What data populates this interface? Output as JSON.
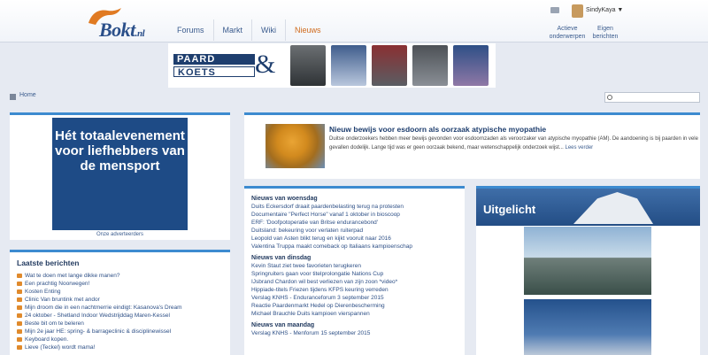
{
  "header": {
    "logo": {
      "text": "Bokt",
      "tld": ".nl"
    },
    "nav": [
      {
        "label": "Forums",
        "active": false
      },
      {
        "label": "Markt",
        "active": false
      },
      {
        "label": "Wiki",
        "active": false
      },
      {
        "label": "Nieuws",
        "active": true
      }
    ],
    "user": {
      "name": "SindyKaya ▼",
      "links": [
        {
          "line1": "Actieve",
          "line2": "onderwerpen"
        },
        {
          "line1": "Eigen",
          "line2": "berichten"
        }
      ]
    }
  },
  "banner": {
    "line1": "PAARD",
    "line2": "KOETS",
    "amp": "&"
  },
  "breadcrumb": {
    "home": "Home"
  },
  "search": {
    "placeholder": ""
  },
  "ad": {
    "text": "Hét totaalevenement voor liefhebbers van de mensport",
    "caption": "Onze adverteerders"
  },
  "latest": {
    "title": "Laatste berichten",
    "items": [
      "Wat te doen met lange dikke manen?",
      "Een prachtig Noorwegen!",
      "Kosten Enting",
      "Clinic Van bruntink met andor",
      "Mijn droom die in een nachtmerrie eindigt: Kasanova's Dream",
      "24 oktober - Shetland Indoor Wedstrijddag Maren-Kessel",
      "Beste bit om te beleren",
      "Mijn 2e jaar HE: spring- & barrageclinic & disciplinewissel",
      "Keyboard kopen.",
      "Lieve (Teckel) wordt mama!"
    ]
  },
  "featured": {
    "title": "Nieuw bewijs voor esdoorn als oorzaak atypische myopathie",
    "text": "Duitse onderzoekers hebben meer bewijs gevonden voor esdoornzaden als veroorzaker van atypische myopathie (AM). De aandoening is bij paarden in vele gevallen dodelijk. Lange tijd was er geen oorzaak bekend, maar wetenschappelijk onderzoek wijst...",
    "read_more": "Lees verder"
  },
  "news": {
    "sections": [
      {
        "title": "Nieuws van woensdag",
        "items": [
          "Duits Eckersdorf draait paardenbelasting terug na protesten",
          "Documentaire \"Perfect Horse\" vanaf 1 oktober in bioscoop",
          "ERF: 'Doofpotoperatie van Britse endurancebond'",
          "Duitsland: bekeuring voor verlaten ruiterpad",
          "Leopold van Asten blikt terug en kijkt vooruit naar 2016",
          "Valentina Truppa maakt comeback op Italiaans kampioenschap"
        ]
      },
      {
        "title": "Nieuws van dinsdag",
        "items": [
          "Kevin Staut ziet twee favorieten terugkeren",
          "Springruiters gaan voor titelprolongatie Nations Cup",
          "IJsbrand Chardon wil best verliezen van zijn zoon *video*",
          "Hippiade-titels Friezen tijdens KFPS keuring verreden",
          "Verslag KNHS - Enduranceforum 3 september 2015",
          "Reactie Paardenmarkt Hedel op Dierenbescherming",
          "Michael Brauchle Duits kampioen vierspannen"
        ]
      },
      {
        "title": "Nieuws van maandag",
        "items": [
          "Verslag KNHS - Menforum 15 september 2015"
        ]
      }
    ]
  },
  "uitgelicht": {
    "title": "Uitgelicht"
  },
  "colors": {
    "accent": "#3d8bd0",
    "nav_active": "#d06a1c",
    "link": "#3b5c8e",
    "ad_bg": "#1e4b86"
  },
  "icons": [
    "mail-icon",
    "home-icon",
    "search-icon"
  ]
}
